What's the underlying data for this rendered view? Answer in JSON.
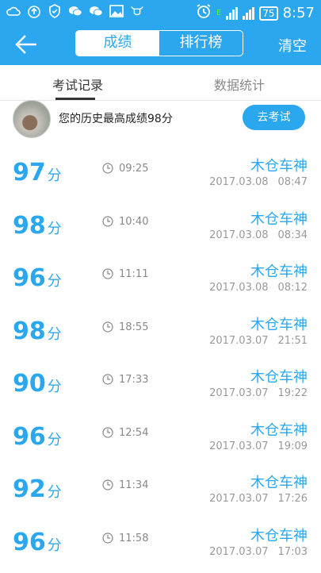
{
  "status_bar": {
    "battery": "75",
    "network": "E",
    "time": "8:57",
    "left_icons": [
      "cloud-icon",
      "cloud-upload-icon",
      "shield-icon",
      "wechat-icon",
      "wechat-icon",
      "image-icon",
      "bull-icon"
    ],
    "right_icons": [
      "alarm-icon",
      "signal-icon",
      "signal-icon",
      "battery-icon"
    ]
  },
  "app_bar": {
    "back_icon": "arrow-left-icon",
    "segments": [
      "成绩",
      "排行榜"
    ],
    "active_segment": "成绩",
    "clear": "清空"
  },
  "tabs": [
    "考试记录",
    "数据统计"
  ],
  "profile": {
    "best_text": "您的历史最高成绩98分",
    "button": "去考试"
  },
  "records": [
    {
      "score": "97",
      "unit": "分",
      "duration": "09:25",
      "name": "木仓车神",
      "date": "2017.03.08",
      "time": "08:47"
    },
    {
      "score": "98",
      "unit": "分",
      "duration": "10:40",
      "name": "木仓车神",
      "date": "2017.03.08",
      "time": "08:34"
    },
    {
      "score": "96",
      "unit": "分",
      "duration": "11:11",
      "name": "木仓车神",
      "date": "2017.03.08",
      "time": "08:12"
    },
    {
      "score": "98",
      "unit": "分",
      "duration": "18:55",
      "name": "木仓车神",
      "date": "2017.03.07",
      "time": "21:51"
    },
    {
      "score": "90",
      "unit": "分",
      "duration": "17:33",
      "name": "木仓车神",
      "date": "2017.03.07",
      "time": "19:22"
    },
    {
      "score": "96",
      "unit": "分",
      "duration": "12:54",
      "name": "木仓车神",
      "date": "2017.03.07",
      "time": "19:09"
    },
    {
      "score": "92",
      "unit": "分",
      "duration": "11:34",
      "name": "木仓车神",
      "date": "2017.03.07",
      "time": "17:26"
    },
    {
      "score": "96",
      "unit": "分",
      "duration": "11:58",
      "name": "木仓车神",
      "date": "2017.03.07",
      "time": "17:03"
    }
  ],
  "colors": {
    "accent": "#2aa7ef",
    "text": "#333333",
    "muted": "#999999"
  }
}
